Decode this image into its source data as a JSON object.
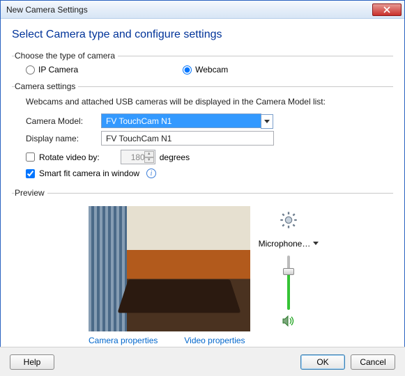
{
  "window": {
    "title": "New Camera Settings"
  },
  "heading": "Select Camera type and configure settings",
  "groups": {
    "type": {
      "legend": "Choose the type of camera",
      "options": {
        "ip": "IP Camera",
        "webcam": "Webcam"
      },
      "selected": "webcam"
    },
    "settings": {
      "legend": "Camera settings",
      "info": "Webcams and attached USB cameras will be displayed in the Camera Model list:",
      "model_label": "Camera Model:",
      "model_value": "FV TouchCam N1",
      "display_label": "Display name:",
      "display_value": "FV TouchCam N1",
      "rotate": {
        "label": "Rotate video by:",
        "value": "180",
        "unit": "degrees",
        "checked": false
      },
      "smartfit": {
        "label": "Smart fit camera in window",
        "checked": true
      }
    },
    "preview": {
      "legend": "Preview",
      "camera_props": "Camera properties",
      "video_props": "Video properties",
      "mic_label": "Microphone…",
      "gear_tooltip": "Settings"
    }
  },
  "footer": {
    "help": "Help",
    "ok": "OK",
    "cancel": "Cancel"
  }
}
